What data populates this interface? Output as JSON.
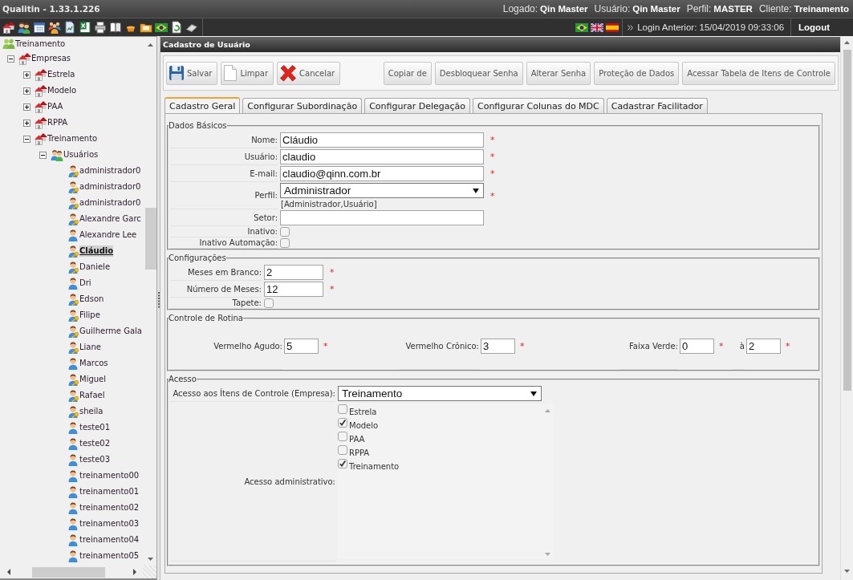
{
  "header": {
    "title": "Qualitin - 1.33.1.226",
    "session": [
      {
        "label": "Logado:",
        "value": "Qin Master"
      },
      {
        "label": "Usuário:",
        "value": "Qin Master"
      },
      {
        "label": "Perfil:",
        "value": "MASTER"
      },
      {
        "label": "Cliente:",
        "value": "Treinamento"
      }
    ],
    "last_login": "Login Anterior: 15/04/2019 09:33:06",
    "logout": "Logout"
  },
  "tree": {
    "label": "Treinamento",
    "kind": "root",
    "selected": false,
    "children": [
      {
        "label": "Empresas",
        "kind": "group",
        "expanded": true,
        "selected": false,
        "children": [
          {
            "label": "Estrela",
            "kind": "company",
            "expanded": false,
            "selected": false
          },
          {
            "label": "Modelo",
            "kind": "company",
            "expanded": false,
            "selected": false
          },
          {
            "label": "PAA",
            "kind": "company",
            "expanded": false,
            "selected": false
          },
          {
            "label": "RPPA",
            "kind": "company",
            "expanded": false,
            "selected": false
          },
          {
            "label": "Treinamento",
            "kind": "company",
            "expanded": true,
            "selected": false,
            "children": [
              {
                "label": "Usuários",
                "kind": "users",
                "expanded": true,
                "selected": false,
                "children": [
                  {
                    "label": "administrador0",
                    "kind": "admin",
                    "selected": false
                  },
                  {
                    "label": "administrador0",
                    "kind": "admin",
                    "selected": false
                  },
                  {
                    "label": "administrador0",
                    "kind": "admin",
                    "selected": false
                  },
                  {
                    "label": "Alexandre Garc",
                    "kind": "admin",
                    "selected": false
                  },
                  {
                    "label": "Alexandre Lee",
                    "kind": "user",
                    "selected": false
                  },
                  {
                    "label": "Cláudio",
                    "kind": "admin",
                    "selected": true
                  },
                  {
                    "label": "Daniele",
                    "kind": "admin",
                    "selected": false
                  },
                  {
                    "label": "Dri",
                    "kind": "user",
                    "selected": false
                  },
                  {
                    "label": "Edson",
                    "kind": "admin",
                    "selected": false
                  },
                  {
                    "label": "Filipe",
                    "kind": "admin",
                    "selected": false
                  },
                  {
                    "label": "Guilherme Gala",
                    "kind": "admin",
                    "selected": false
                  },
                  {
                    "label": "Liane",
                    "kind": "admin",
                    "selected": false
                  },
                  {
                    "label": "Marcos",
                    "kind": "user",
                    "selected": false
                  },
                  {
                    "label": "Miguel",
                    "kind": "admin",
                    "selected": false
                  },
                  {
                    "label": "Rafael",
                    "kind": "admin",
                    "selected": false
                  },
                  {
                    "label": "sheila",
                    "kind": "admin",
                    "selected": false
                  },
                  {
                    "label": "teste01",
                    "kind": "user",
                    "selected": false
                  },
                  {
                    "label": "teste02",
                    "kind": "user",
                    "selected": false
                  },
                  {
                    "label": "teste03",
                    "kind": "user",
                    "selected": false
                  },
                  {
                    "label": "treinamento00",
                    "kind": "user",
                    "selected": false
                  },
                  {
                    "label": "treinamento01",
                    "kind": "user",
                    "selected": false
                  },
                  {
                    "label": "treinamento02",
                    "kind": "user",
                    "selected": false
                  },
                  {
                    "label": "treinamento03",
                    "kind": "user",
                    "selected": false
                  },
                  {
                    "label": "treinamento04",
                    "kind": "user",
                    "selected": false
                  },
                  {
                    "label": "treinamento05",
                    "kind": "user",
                    "selected": false
                  }
                ]
              }
            ]
          }
        ]
      }
    ]
  },
  "panel": {
    "title": "Cadastro de Usuário",
    "actions": [
      {
        "label": "Salvar",
        "kind": "save"
      },
      {
        "label": "Limpar",
        "kind": "clear"
      },
      {
        "label": "Cancelar",
        "kind": "cancel"
      },
      {
        "label": "Copiar de",
        "kind": "text"
      },
      {
        "label": "Desbloquear Senha",
        "kind": "text"
      },
      {
        "label": "Alterar Senha",
        "kind": "text"
      },
      {
        "label": "Proteção de Dados",
        "kind": "text"
      },
      {
        "label": "Acessar Tabela de Itens de Controle",
        "kind": "text"
      }
    ],
    "tabs": [
      {
        "label": "Cadastro Geral",
        "selected": true
      },
      {
        "label": "Configurar Subordinação",
        "selected": false
      },
      {
        "label": "Configurar Delegação",
        "selected": false
      },
      {
        "label": "Configurar Colunas do MDC",
        "selected": false
      },
      {
        "label": "Cadastrar Facilitador",
        "selected": false
      }
    ],
    "sections": [
      {
        "title": "Dados Básicos",
        "kind": "wide-form",
        "fields": [
          {
            "kind": "text",
            "label": "Nome:",
            "value": "Cláudio",
            "required_mark": "*"
          },
          {
            "kind": "text",
            "label": "Usuário:",
            "value": "claudio",
            "required_mark": "*"
          },
          {
            "kind": "text",
            "label": "E-mail:",
            "value": "claudio@qinn.com.br",
            "required_mark": "*"
          },
          {
            "kind": "select",
            "label": "Perfil:",
            "value": "Administrador",
            "required_mark": "*",
            "note": "[Administrador,Usuário]"
          },
          {
            "kind": "text",
            "label": "Setor:"
          },
          {
            "kind": "checkbox",
            "label": "Inativo:",
            "checked": false
          },
          {
            "kind": "checkbox",
            "label": "Inativo Automação:",
            "checked": false
          }
        ]
      },
      {
        "title": "Configurações",
        "kind": "narrow-form",
        "fields": [
          {
            "kind": "text",
            "label": "Meses em Branco:",
            "value": "2",
            "required_mark": "*"
          },
          {
            "kind": "text",
            "label": "Número de Meses:",
            "value": "12",
            "required_mark": "*"
          },
          {
            "kind": "checkbox",
            "label": "Tapete:",
            "checked": false
          }
        ]
      },
      {
        "title": "Controle de Rotina",
        "kind": "inline",
        "fields": [
          {
            "kind": "text",
            "label": "Vermelho Agudo:",
            "value": "5",
            "required_mark": "*"
          },
          {
            "kind": "text",
            "label": "Vermelho Crônico:",
            "value": "3",
            "required_mark": "*"
          },
          {
            "kind": "text",
            "label": "Faixa Verde:",
            "value": "0",
            "required_mark": "*"
          },
          {
            "kind": "text",
            "label": "à",
            "value": "2",
            "required_mark": "*"
          }
        ]
      },
      {
        "title": "Acesso",
        "kind": "access",
        "fields": [
          {
            "kind": "select",
            "label": "Acesso aos Ítens de Controle (Empresa):",
            "value": "Treinamento"
          },
          {
            "kind": "checklist",
            "label": "Acesso administrativo:",
            "options": [
              {
                "label": "Estrela",
                "checked": false
              },
              {
                "label": "Modelo",
                "checked": true
              },
              {
                "label": "PAA",
                "checked": false
              },
              {
                "label": "RPPA",
                "checked": false
              },
              {
                "label": "Treinamento",
                "checked": true
              }
            ]
          }
        ]
      }
    ]
  }
}
